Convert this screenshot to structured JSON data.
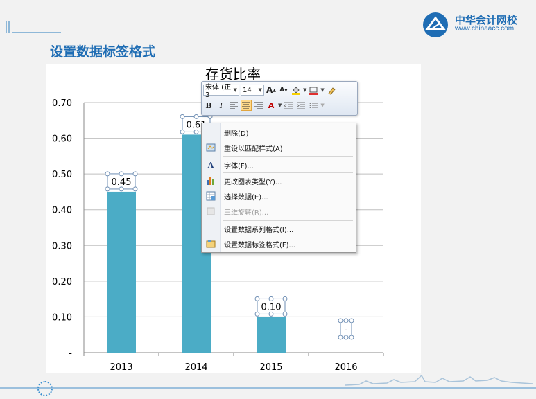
{
  "slide": {
    "title": "设置数据标签格式",
    "logo_name": "中华会计网校",
    "logo_url": "www.chinaacc.com",
    "accent_color": "#1f6db4"
  },
  "chart_data": {
    "type": "bar",
    "title": "存货比率",
    "categories": [
      "2013",
      "2014",
      "2015",
      "2016"
    ],
    "values": [
      0.45,
      0.61,
      0.1,
      null
    ],
    "data_labels": [
      "0.45",
      "0.61",
      "0.10",
      "-"
    ],
    "ylim": [
      0,
      0.7
    ],
    "yticks": [
      "-",
      "0.10",
      "0.20",
      "0.30",
      "0.40",
      "0.50",
      "0.60",
      "0.70"
    ],
    "grid": true,
    "bar_color": "#4bacc6"
  },
  "mini_toolbar": {
    "font_name": "宋体 (正3",
    "font_size": "14",
    "grow_font": "A",
    "shrink_font": "A",
    "bold": "B",
    "italic": "I",
    "font_color": "A"
  },
  "context_menu": {
    "items": [
      {
        "label": "删除(D)",
        "icon": "none-icon",
        "enabled": true
      },
      {
        "label": "重设以匹配样式(A)",
        "icon": "reset-style-icon",
        "enabled": true
      },
      {
        "label": "字体(F)...",
        "icon": "font-icon",
        "enabled": true
      },
      {
        "label": "更改图表类型(Y)...",
        "icon": "chart-type-icon",
        "enabled": true
      },
      {
        "label": "选择数据(E)...",
        "icon": "select-data-icon",
        "enabled": true
      },
      {
        "label": "三维旋转(R)...",
        "icon": "rotate-3d-icon",
        "enabled": false
      },
      {
        "label": "设置数据系列格式(I)...",
        "icon": "none-icon",
        "enabled": true
      },
      {
        "label": "设置数据标签格式(F)...",
        "icon": "format-label-icon",
        "enabled": true
      }
    ]
  }
}
